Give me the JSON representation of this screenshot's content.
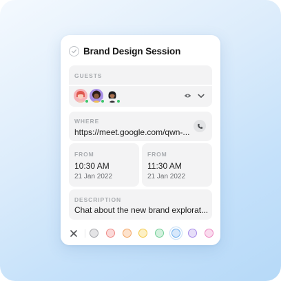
{
  "event": {
    "title": "Brand Design Session"
  },
  "guests": {
    "label": "GUESTS",
    "avatars": [
      {
        "name": "guest-avatar-1",
        "bg": "#f6b3b8",
        "online": true
      },
      {
        "name": "guest-avatar-2",
        "bg": "#a88fe6",
        "online": true
      },
      {
        "name": "guest-avatar-3",
        "bg": "#ffffff",
        "online": true
      }
    ],
    "icons": [
      "eye-icon",
      "chevron-down-icon"
    ]
  },
  "where": {
    "label": "WHERE",
    "value": "https://meet.google.com/qwn-...",
    "icon": "phone-icon"
  },
  "from_start": {
    "label": "FROM",
    "time": "10:30 AM",
    "date": "21 Jan 2022"
  },
  "from_end": {
    "label": "FROM",
    "time": "11:30 AM",
    "date": "21 Jan 2022"
  },
  "description": {
    "label": "DESCRIPTION",
    "value": "Chat about the new brand explorat..."
  },
  "colors": {
    "selected": "blue",
    "swatches": [
      {
        "name": "gray",
        "fill": "#e4e4e6",
        "ring": "#a3a5a9"
      },
      {
        "name": "red",
        "fill": "#fbd9d8",
        "ring": "#ef8a86"
      },
      {
        "name": "orange",
        "fill": "#fde2cc",
        "ring": "#f2a462"
      },
      {
        "name": "yellow",
        "fill": "#fdf0c4",
        "ring": "#f3c94b"
      },
      {
        "name": "green",
        "fill": "#d3f1de",
        "ring": "#73cf97"
      },
      {
        "name": "blue",
        "fill": "#d7e8fb",
        "ring": "#6fb0ef"
      },
      {
        "name": "purple",
        "fill": "#e6def9",
        "ring": "#a88be9"
      },
      {
        "name": "pink",
        "fill": "#fadbee",
        "ring": "#ec88c2"
      }
    ]
  }
}
